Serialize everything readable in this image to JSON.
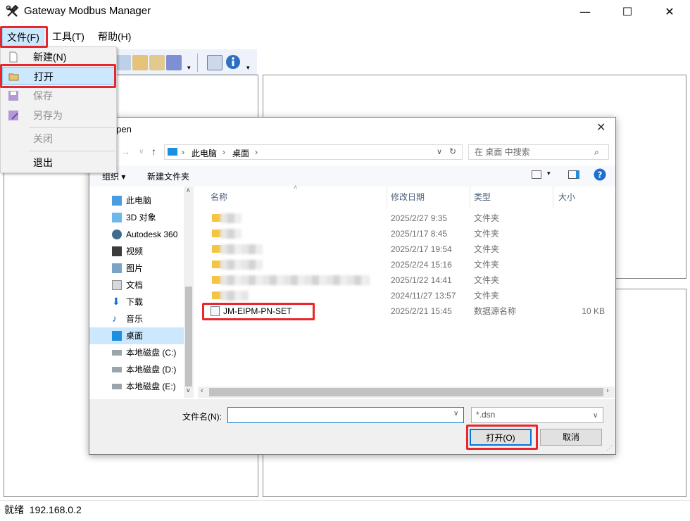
{
  "window": {
    "title": "Gateway Modbus Manager",
    "controls": {
      "minimize": "—",
      "maximize": "☐",
      "close": "✕"
    }
  },
  "menubar": {
    "file": "文件(F)",
    "tools": "工具(T)",
    "help": "帮助(H)"
  },
  "file_menu": {
    "new": "新建(N)",
    "open": "打开",
    "save": "保存",
    "save_as": "另存为",
    "close": "关闭",
    "exit": "退出"
  },
  "status": {
    "ready": "就绪",
    "ip": "192.168.0.2"
  },
  "dialog": {
    "title": "Open",
    "close_glyph": "✕",
    "breadcrumb": [
      "此电脑",
      "桌面"
    ],
    "search_placeholder": "在 桌面 中搜索",
    "organize": "组织 ▾",
    "new_folder": "新建文件夹",
    "nav": [
      "此电脑",
      "3D 对象",
      "Autodesk 360",
      "视频",
      "图片",
      "文档",
      "下载",
      "音乐",
      "桌面",
      "本地磁盘 (C:)",
      "本地磁盘 (D:)",
      "本地磁盘 (E:)"
    ],
    "columns": {
      "name": "名称",
      "modified": "修改日期",
      "type": "类型",
      "size": "大小"
    },
    "rows": [
      {
        "date": "2025/2/27 9:35",
        "type": "文件夹"
      },
      {
        "date": "2025/1/17 8:45",
        "type": "文件夹"
      },
      {
        "date": "2025/2/17 19:54",
        "type": "文件夹"
      },
      {
        "date": "2025/2/24 15:16",
        "type": "文件夹"
      },
      {
        "date": "2025/1/22 14:41",
        "type": "文件夹"
      },
      {
        "date": "2024/11/27 13:57",
        "type": "文件夹"
      }
    ],
    "dsn_file": {
      "name": "JM-EIPM-PN-SET",
      "date": "2025/2/21 15:45",
      "type": "数据源名称",
      "size": "10 KB"
    },
    "filename_label": "文件名(N):",
    "filename_value": "",
    "filetype": "*.dsn",
    "open_button": "打开(O)",
    "cancel_button": "取消"
  },
  "colors": {
    "highlight_red": "#e8262b",
    "selection_blue": "#cce8ff",
    "accent": "#0078d7"
  }
}
